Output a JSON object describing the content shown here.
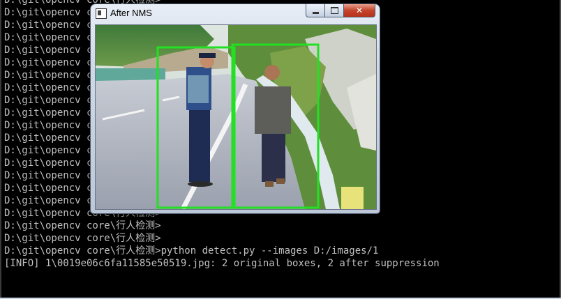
{
  "console": {
    "lines": [
      "D:\\git\\opencv core\\行人检测>",
      "D:\\git\\opencv core\\行人检测>",
      "D:\\git\\opencv core\\行人检测>",
      "D:\\git\\opencv core\\行人检测>",
      "D:\\git\\opencv core\\行人检测>",
      "D:\\git\\opencv core\\行人检测>",
      "D:\\git\\opencv core\\行人检测>",
      "D:\\git\\opencv core\\行人检测>",
      "D:\\git\\opencv core\\行人检测>",
      "D:\\git\\opencv core\\行人检测>",
      "D:\\git\\opencv core\\行人检测>",
      "D:\\git\\opencv core\\行人检测>",
      "D:\\git\\opencv core\\行人检测>",
      "D:\\git\\opencv core\\行人检测>",
      "D:\\git\\opencv core\\行人检测>",
      "D:\\git\\opencv core\\行人检测>",
      "D:\\git\\opencv core\\行人检测>",
      "D:\\git\\opencv core\\行人检测>",
      "D:\\git\\opencv core\\行人检测>",
      "D:\\git\\opencv core\\行人检测>",
      "D:\\git\\opencv core\\行人检测>python detect.py --images D:/images/1",
      "[INFO] 1\\0019e06c6fa11585e50519.jpg: 2 original boxes, 2 after suppression"
    ],
    "text_color": "#c0c0c0",
    "background": "#000000"
  },
  "window": {
    "title": "After NMS",
    "close_glyph": "✕",
    "box_color": "#22e022",
    "box_count": 2
  }
}
